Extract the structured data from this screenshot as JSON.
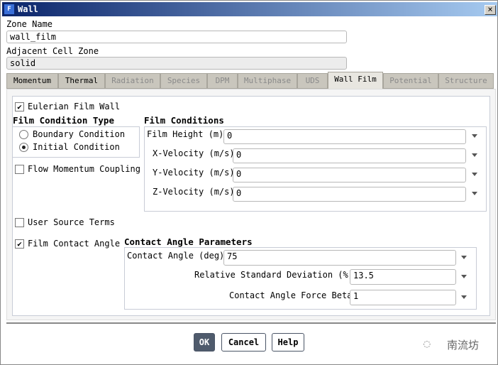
{
  "window": {
    "title": "Wall",
    "icon_letter": "F",
    "close": "×"
  },
  "zone_name": {
    "label": "Zone Name",
    "value": "wall_film"
  },
  "adjacent": {
    "label": "Adjacent Cell Zone",
    "value": "solid"
  },
  "tabs": [
    "Momentum",
    "Thermal",
    "Radiation",
    "Species",
    "DPM",
    "Multiphase",
    "UDS",
    "Wall Film",
    "Potential",
    "Structure"
  ],
  "wall_film": {
    "eulerian": {
      "label": "Eulerian Film Wall",
      "checked": true
    },
    "film_condition_type": {
      "title": "Film Condition Type",
      "options": [
        "Boundary Condition",
        "Initial Condition"
      ],
      "selected": "Initial Condition"
    },
    "flow_momentum": {
      "label": "Flow Momentum Coupling",
      "checked": false
    },
    "film_conditions": {
      "title": "Film Conditions",
      "rows": [
        {
          "label": "Film Height (m)",
          "value": "0"
        },
        {
          "label": "X-Velocity (m/s)",
          "value": "0"
        },
        {
          "label": "Y-Velocity (m/s)",
          "value": "0"
        },
        {
          "label": "Z-Velocity (m/s)",
          "value": "0"
        }
      ]
    },
    "user_source": {
      "label": "User Source Terms",
      "checked": false
    },
    "contact_angle": {
      "label": "Film Contact Angle",
      "checked": true
    },
    "contact_params": {
      "title": "Contact Angle Parameters",
      "rows": [
        {
          "label": "Contact Angle (deg)",
          "value": "75"
        },
        {
          "label": "Relative Standard Deviation (%)",
          "value": "13.5"
        },
        {
          "label": "Contact Angle Force Beta",
          "value": "1"
        }
      ]
    }
  },
  "buttons": {
    "ok": "OK",
    "cancel": "Cancel",
    "help": "Help"
  },
  "watermark": "南流坊"
}
